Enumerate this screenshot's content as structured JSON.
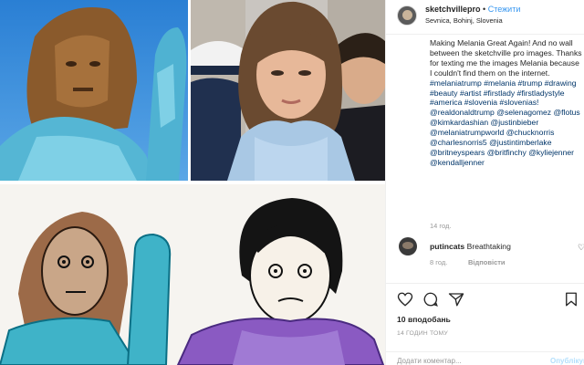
{
  "header": {
    "username": "sketchvillepro",
    "separator": "•",
    "follow_label": "Стежити",
    "location": "Sevnica, Bohinj, Slovenia"
  },
  "caption": {
    "text": "Making Melania Great Again! And no wall between the sketchville pro images. Thanks for texting me the images Melania because I couldn't find them on the internet.",
    "hashtags": "#melaniatrump #melania #trump #drawing #beauty #artist #firstlady #firstladystyle #america #slovenia #slovenias! @realdonaldtrump @selenagomez @flotus @kimkardashian @justinbieber @melaniatrumpworld @chucknorris @charlesnorris5 @justintimberlake @britneyspears @britfinchy @kyliejenner @kendalljenner",
    "time": "14 год."
  },
  "comment": {
    "username": "putincats",
    "text": "Breathtaking",
    "time": "8 год.",
    "reply_label": "Відповісти"
  },
  "actions": {
    "like_icon": "heart-icon",
    "comment_icon": "comment-icon",
    "share_icon": "share-icon"
  },
  "likes_label": "10 вподобань",
  "time_ago": "14 ГОДИН ТОМУ",
  "add_comment": {
    "placeholder": "Додати коментар...",
    "post_label": "Опублікувати"
  },
  "colors": {
    "link": "#3897f0",
    "hashtag": "#003569",
    "muted": "#999999"
  }
}
